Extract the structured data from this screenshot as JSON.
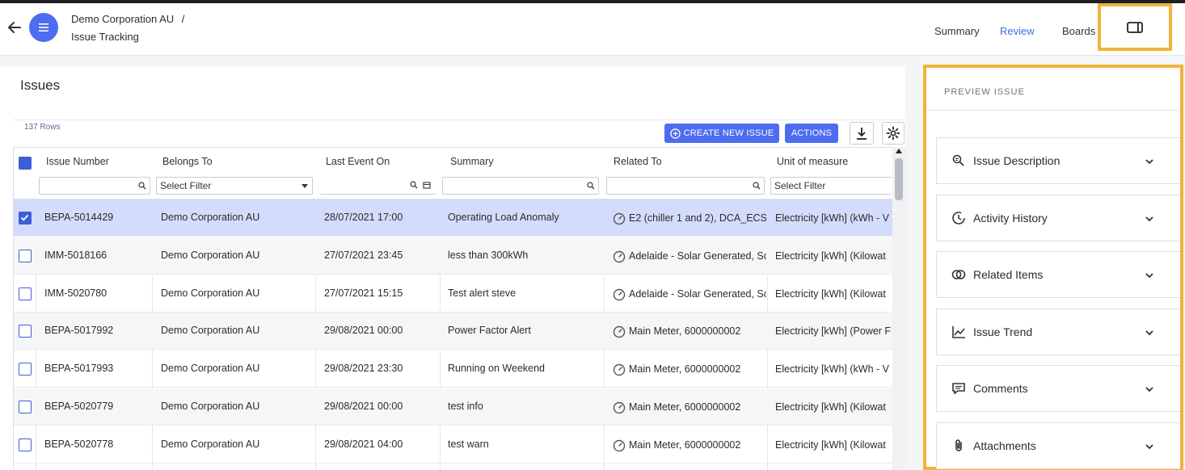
{
  "header": {
    "breadcrumb_org": "Demo Corporation AU",
    "breadcrumb_sep": "/",
    "breadcrumb_page": "Issue Tracking",
    "nav": {
      "summary": "Summary",
      "review": "Review",
      "boards": "Boards"
    }
  },
  "issues": {
    "title": "Issues",
    "row_count": "137 Rows",
    "create_button": "CREATE NEW ISSUE",
    "actions_button": "ACTIONS"
  },
  "table": {
    "columns": {
      "issue_number": "Issue Number",
      "belongs_to": "Belongs To",
      "last_event_on": "Last Event On",
      "summary": "Summary",
      "related_to": "Related To",
      "unit_of_measure": "Unit of measure"
    },
    "filters": {
      "belongs_to": "Select Filter",
      "unit_of_measure": "Select Filter"
    },
    "rows": [
      {
        "issue": "BEPA-5014429",
        "belongs": "Demo Corporation AU",
        "last": "28/07/2021 17:00",
        "summary": "Operating Load Anomaly",
        "related": "E2 (chiller 1 and 2), DCA_ECS",
        "unit": "Electricity [kWh] (kWh - V",
        "selected": true
      },
      {
        "issue": "IMM-5018166",
        "belongs": "Demo Corporation AU",
        "last": "27/07/2021 23:45",
        "summary": "less than 300kWh",
        "related": "Adelaide - Solar Generated, Sc",
        "unit": "Electricity [kWh] (Kilowat",
        "selected": false
      },
      {
        "issue": "IMM-5020780",
        "belongs": "Demo Corporation AU",
        "last": "27/07/2021 15:15",
        "summary": "Test alert steve",
        "related": "Adelaide - Solar Generated, Sc",
        "unit": "Electricity [kWh] (Kilowat",
        "selected": false
      },
      {
        "issue": "BEPA-5017992",
        "belongs": "Demo Corporation AU",
        "last": "29/08/2021 00:00",
        "summary": "Power Factor Alert",
        "related": "Main Meter, 6000000002",
        "unit": "Electricity [kWh] (Power F",
        "selected": false
      },
      {
        "issue": "BEPA-5017993",
        "belongs": "Demo Corporation AU",
        "last": "29/08/2021 23:30",
        "summary": "Running on Weekend",
        "related": "Main Meter, 6000000002",
        "unit": "Electricity [kWh] (kWh - V",
        "selected": false
      },
      {
        "issue": "BEPA-5020779",
        "belongs": "Demo Corporation AU",
        "last": "29/08/2021 00:00",
        "summary": "test info",
        "related": "Main Meter, 6000000002",
        "unit": "Electricity [kWh] (Kilowat",
        "selected": false
      },
      {
        "issue": "BEPA-5020778",
        "belongs": "Demo Corporation AU",
        "last": "29/08/2021 04:00",
        "summary": "test warn",
        "related": "Main Meter, 6000000002",
        "unit": "Electricity [kWh] (Kilowat",
        "selected": false
      }
    ]
  },
  "preview": {
    "title": "PREVIEW ISSUE",
    "sections": [
      {
        "label": "Issue Description",
        "icon": "search-document-icon"
      },
      {
        "label": "Activity History",
        "icon": "history-icon"
      },
      {
        "label": "Related Items",
        "icon": "link-circles-icon"
      },
      {
        "label": "Issue Trend",
        "icon": "line-chart-icon"
      },
      {
        "label": "Comments",
        "icon": "comment-icon"
      },
      {
        "label": "Attachments",
        "icon": "paperclip-icon"
      }
    ]
  },
  "colors": {
    "accent": "#4d6cf0",
    "highlight": "#f0b43a",
    "selected_row": "#d4dcfb"
  }
}
